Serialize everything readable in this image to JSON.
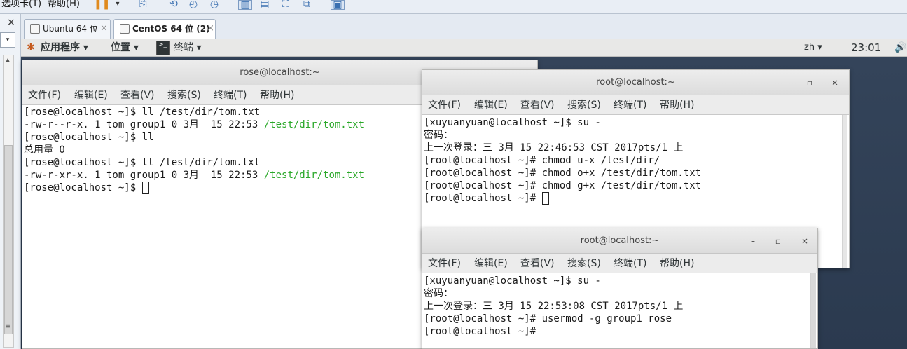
{
  "vm_menu": {
    "tabs_menu": "选项卡(T)",
    "help_menu": "帮助(H)"
  },
  "vm_tabs": [
    {
      "label": "Ubuntu 64 位",
      "close": "×"
    },
    {
      "label": "CentOS 64 位 (2)",
      "close": "×"
    }
  ],
  "gnome_bar": {
    "applications": "应用程序",
    "places": "位置",
    "terminal": "终端",
    "input_method": "zh",
    "clock": "23:01",
    "dropdown_arrow": "▾"
  },
  "terminal_menus": [
    "文件(F)",
    "编辑(E)",
    "查看(V)",
    "搜索(S)",
    "终端(T)",
    "帮助(H)"
  ],
  "win_rose": {
    "title": "rose@localhost:~",
    "lines": [
      {
        "text": "[rose@localhost ~]$ ll /test/dir/tom.txt",
        "green": ""
      },
      {
        "text": "-rw-r--r-x. 1 tom group1 0 3月  15 22:53 ",
        "green": "/test/dir/tom.txt"
      },
      {
        "text": "[rose@localhost ~]$ ll",
        "green": ""
      },
      {
        "text": "总用量 0",
        "green": ""
      },
      {
        "text": "[rose@localhost ~]$ ll /test/dir/tom.txt",
        "green": ""
      },
      {
        "text": "-rw-r-xr-x. 1 tom group1 0 3月  15 22:53 ",
        "green": "/test/dir/tom.txt"
      },
      {
        "text": "[rose@localhost ~]$ ",
        "green": ""
      }
    ]
  },
  "win_root1": {
    "title": "root@localhost:~",
    "lines": [
      "[xuyuanyuan@localhost ~]$ su -",
      "密码：",
      "上一次登录：三 3月 15 22:46:53 CST 2017pts/1 上",
      "[root@localhost ~]# chmod u-x /test/dir/",
      "[root@localhost ~]# chmod o+x /test/dir/tom.txt",
      "[root@localhost ~]# chmod g+x /test/dir/tom.txt",
      "[root@localhost ~]# "
    ]
  },
  "win_root2": {
    "title": "root@localhost:~",
    "lines": [
      "[xuyuanyuan@localhost ~]$ su -",
      "密码：",
      "上一次登录：三 3月 15 22:53:08 CST 2017pts/1 上",
      "[root@localhost ~]# usermod -g group1 rose",
      "[root@localhost ~]#"
    ]
  },
  "window_buttons": {
    "minimize": "–",
    "maximize": "▫",
    "close": "×"
  }
}
